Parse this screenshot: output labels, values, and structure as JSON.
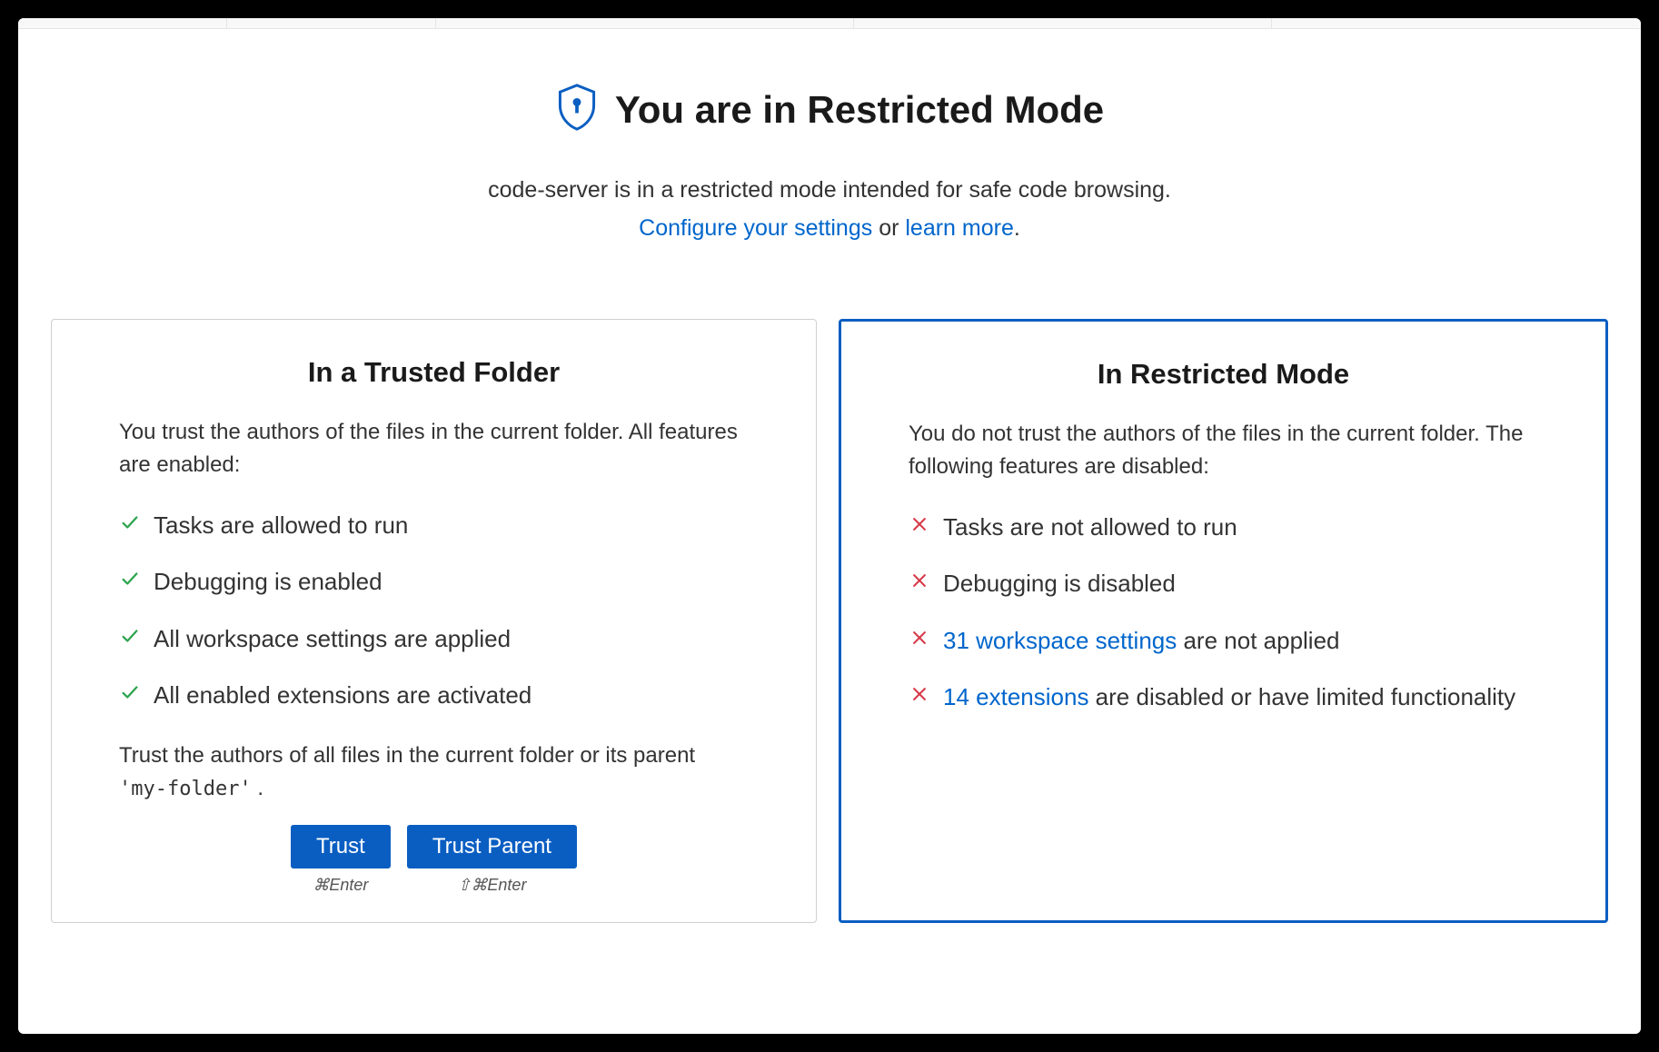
{
  "header": {
    "title": "You are in Restricted Mode",
    "subtitle_line1": "code-server is in a restricted mode intended for safe code browsing.",
    "configure_link": "Configure your settings",
    "or_text": " or ",
    "learn_more_link": "learn more",
    "period": "."
  },
  "trusted_panel": {
    "title": "In a Trusted Folder",
    "description": "You trust the authors of the files in the current folder. All features are enabled:",
    "features": [
      "Tasks are allowed to run",
      "Debugging is enabled",
      "All workspace settings are applied",
      "All enabled extensions are activated"
    ],
    "trust_prompt_pre": "Trust the authors of all files in the current folder or its parent ",
    "folder_name": "'my-folder'",
    "trust_prompt_post": " .",
    "trust_button": "Trust",
    "trust_keybind": "⌘Enter",
    "trust_parent_button": "Trust Parent",
    "trust_parent_keybind": "⇧⌘Enter"
  },
  "restricted_panel": {
    "title": "In Restricted Mode",
    "description": "You do not trust the authors of the files in the current folder. The following features are disabled:",
    "features": [
      {
        "text": "Tasks are not allowed to run"
      },
      {
        "text": "Debugging is disabled"
      },
      {
        "link": "31 workspace settings",
        "text_after": " are not applied"
      },
      {
        "link": "14 extensions",
        "text_after": " are disabled or have limited functionality"
      }
    ]
  }
}
